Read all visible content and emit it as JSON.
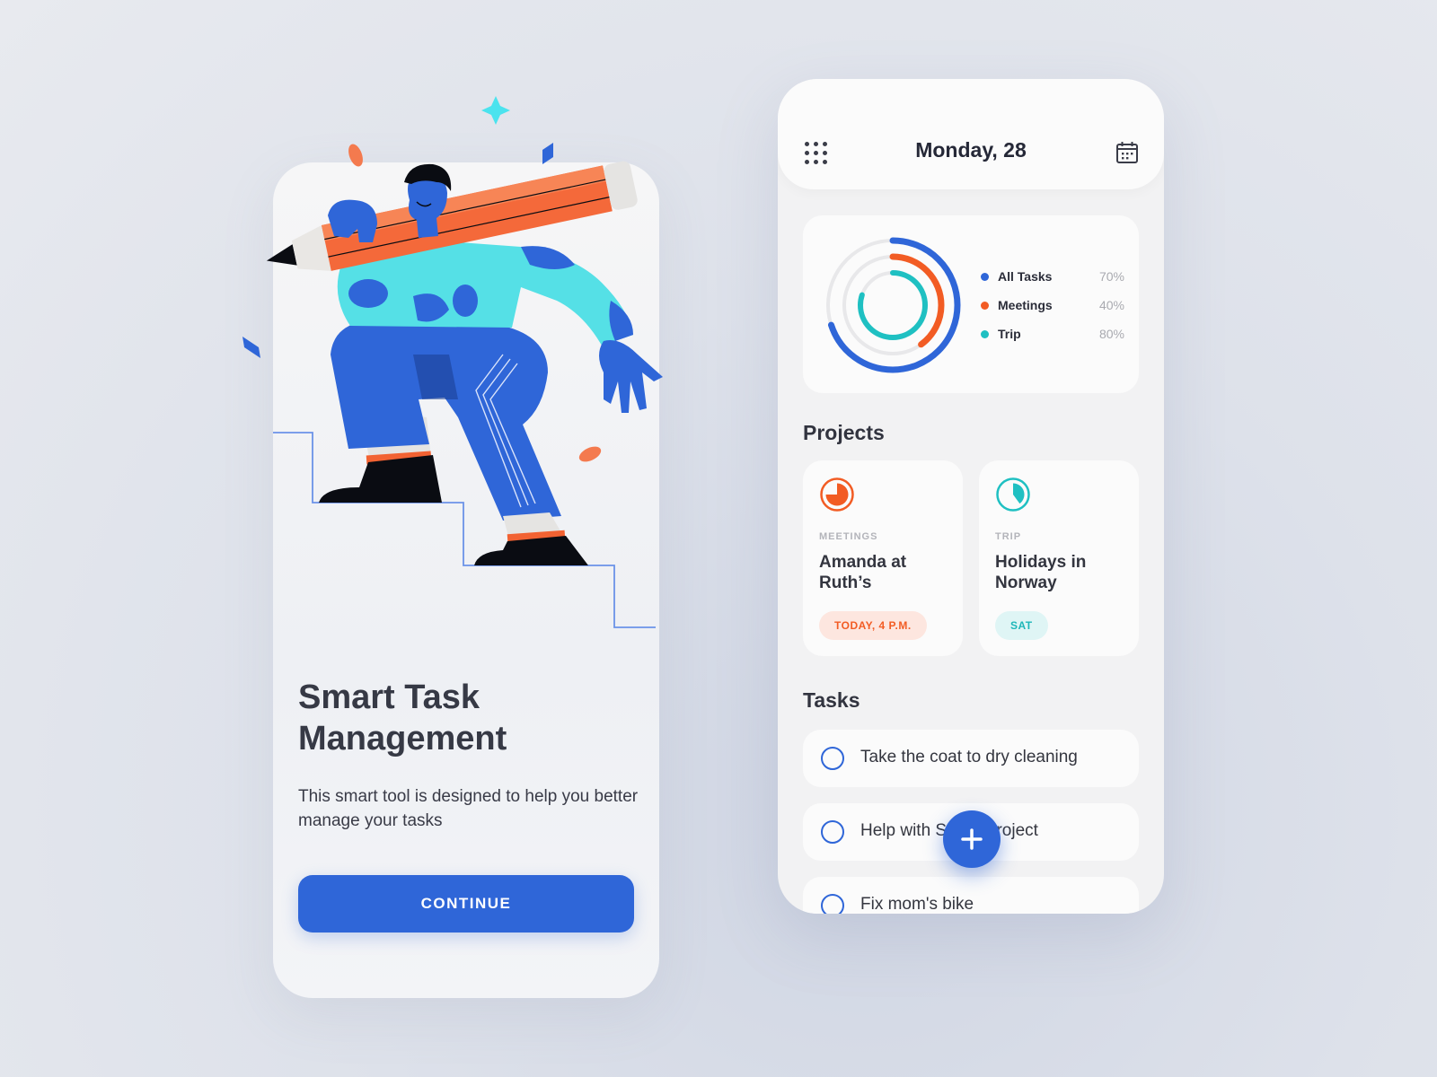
{
  "onboarding": {
    "title_line1": "Smart Task",
    "title_line2": "Management",
    "description": "This smart tool is designed to help you better manage your tasks",
    "continue_label": "CONTINUE",
    "illustration": "person-carrying-pencil-climbing-stairs"
  },
  "dashboard": {
    "header": {
      "menu_icon": "grid-menu-icon",
      "date": "Monday, 28",
      "calendar_icon": "calendar-icon"
    },
    "progress": {
      "items": [
        {
          "label": "All Tasks",
          "value": "70%",
          "percent": 70,
          "color": "#2f66d8"
        },
        {
          "label": "Meetings",
          "value": "40%",
          "percent": 40,
          "color": "#f25c24"
        },
        {
          "label": "Trip",
          "value": "80%",
          "percent": 80,
          "color": "#1fc0c2"
        }
      ]
    },
    "projects_title": "Projects",
    "projects": [
      {
        "category": "MEETINGS",
        "name": "Amanda at Ruth’s",
        "badge": "TODAY, 4 P.M.",
        "color": "#f25c24",
        "badge_bg": "#fde6df",
        "progress": 0.75
      },
      {
        "category": "TRIP",
        "name": "Holidays in Norway",
        "badge": "SAT",
        "color": "#1fc0c2",
        "badge_bg": "#dff5f5",
        "progress": 0.4
      }
    ],
    "tasks_title": "Tasks",
    "tasks": [
      {
        "label": "Take the coat to dry cleaning",
        "done": false
      },
      {
        "label": "Help with Sam's project",
        "done": false
      },
      {
        "label": "Fix mom's bike",
        "done": false
      }
    ],
    "fab_icon": "plus-icon"
  }
}
